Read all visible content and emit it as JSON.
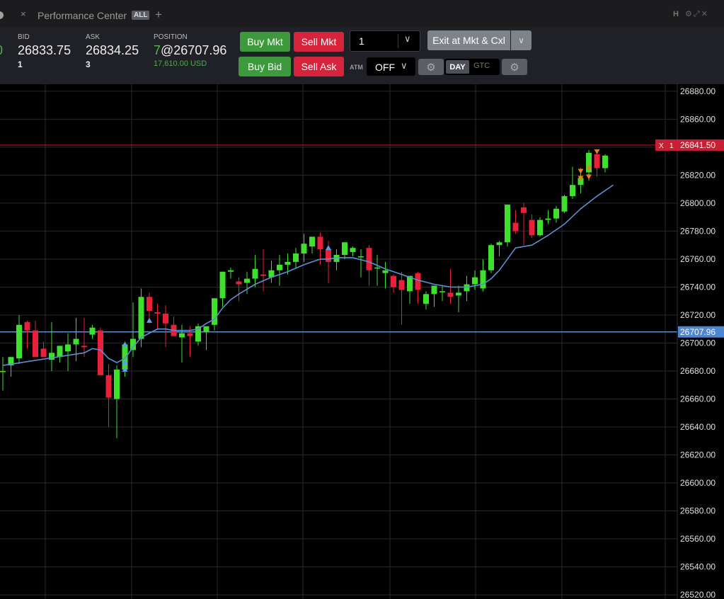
{
  "tab": {
    "title": "Performance Center",
    "badge": "ALL",
    "close_glyph": "×",
    "add_glyph": "+",
    "window_letter": "H"
  },
  "quote": {
    "left_stub": "0",
    "bid_label": "BID",
    "bid_price": "26833.75",
    "bid_size": "1",
    "ask_label": "ASK",
    "ask_price": "26834.25",
    "ask_size": "3",
    "position_label": "POSITION",
    "position_qty": "7",
    "position_price": "@26707.96",
    "position_value": "17,610.00 USD"
  },
  "buttons": {
    "buy_mkt": "Buy Mkt",
    "sell_mkt": "Sell Mkt",
    "buy_bid": "Buy Bid",
    "sell_ask": "Sell Ask",
    "exit": "Exit at Mkt & Cxl"
  },
  "quantity": {
    "value": "1"
  },
  "atm": {
    "label": "ATM",
    "value": "OFF"
  },
  "tif": {
    "day": "DAY",
    "gtc": "GTC",
    "selected": "DAY"
  },
  "icons": {
    "close": "close-icon",
    "add": "plus-icon",
    "gear": "gear-icon",
    "chevron": "chevron-down-icon",
    "settings": "gear-icon",
    "popout": "popout-icon",
    "pin": "pin-icon"
  },
  "colors": {
    "up_candle": "#3fdf2e",
    "down_candle": "#e8203a",
    "ema": "#5d8fd4",
    "order_line": "#c2192f",
    "position_line": "#5b8fd0",
    "buy_button": "#3c9a3c",
    "sell_button": "#d6243d"
  },
  "chart_data": {
    "type": "candlestick",
    "y_axis_ticks": [
      "26880.00",
      "26860.00",
      "26840.00",
      "26820.00",
      "26800.00",
      "26780.00",
      "26760.00",
      "26740.00",
      "26720.00",
      "26700.00",
      "26680.00",
      "26660.00",
      "26640.00",
      "26620.00",
      "26600.00",
      "26580.00",
      "26560.00",
      "26540.00",
      "26520.00"
    ],
    "ylim": [
      26517,
      26885
    ],
    "order_marker": {
      "label_x": "X",
      "label_qty": "1",
      "price": "26841.50"
    },
    "position_marker": {
      "price": "26707.96"
    },
    "candles": [
      [
        26680,
        26690,
        26666,
        26680
      ],
      [
        26684,
        26690,
        26676,
        26690
      ],
      [
        26689,
        26720,
        26685,
        26713
      ],
      [
        26715,
        26716,
        26696,
        26709
      ],
      [
        26709,
        26716,
        26694,
        26690
      ],
      [
        26696,
        26701,
        26690,
        26690
      ],
      [
        26688,
        26715,
        26680,
        26693
      ],
      [
        26690,
        26698,
        26686,
        26698
      ],
      [
        26694,
        26707,
        26680,
        26699
      ],
      [
        26699,
        26718,
        26687,
        26703
      ],
      [
        26698,
        26718,
        26690,
        26697
      ],
      [
        26706,
        26713,
        26703,
        26711
      ],
      [
        26709,
        26711,
        26686,
        26677
      ],
      [
        26677,
        26685,
        26640,
        26661
      ],
      [
        26660,
        26684,
        26632,
        26681
      ],
      [
        26681,
        26701,
        26676,
        26699
      ],
      [
        26695,
        26729,
        26690,
        26703
      ],
      [
        26703,
        26739,
        26697,
        26733
      ],
      [
        26733,
        26736,
        26714,
        26723
      ],
      [
        26722,
        26728,
        26710,
        26721
      ],
      [
        26721,
        26727,
        26697,
        26714
      ],
      [
        26713,
        26719,
        26706,
        26705
      ],
      [
        26704,
        26713,
        26686,
        26707
      ],
      [
        26707,
        26712,
        26690,
        26705
      ],
      [
        26701,
        26714,
        26698,
        26712
      ],
      [
        26708,
        26711,
        26695,
        26712
      ],
      [
        26713,
        26725,
        26709,
        26732
      ],
      [
        26732,
        26751,
        26726,
        26751
      ],
      [
        26751,
        26754,
        26746,
        26752
      ],
      [
        26744,
        26747,
        26730,
        26742
      ],
      [
        26743,
        26751,
        26735,
        26746
      ],
      [
        26746,
        26763,
        26740,
        26753
      ],
      [
        26749,
        26767,
        26737,
        26748
      ],
      [
        26747,
        26759,
        26743,
        26752
      ],
      [
        26752,
        26763,
        26741,
        26756
      ],
      [
        26756,
        26764,
        26749,
        26758
      ],
      [
        26758,
        26768,
        26753,
        26764
      ],
      [
        26764,
        26778,
        26758,
        26771
      ],
      [
        26769,
        26776,
        26764,
        26776
      ],
      [
        26776,
        26779,
        26756,
        26767
      ],
      [
        26767,
        26773,
        26743,
        26758
      ],
      [
        26758,
        26767,
        26752,
        26763
      ],
      [
        26763,
        26772,
        26760,
        26772
      ],
      [
        26765,
        26769,
        26762,
        26768
      ],
      [
        26762,
        26767,
        26747,
        26762
      ],
      [
        26768,
        26770,
        26741,
        26752
      ],
      [
        26754,
        26763,
        26741,
        26754
      ],
      [
        26750,
        26758,
        26739,
        26752
      ],
      [
        26748,
        26749,
        26736,
        26740
      ],
      [
        26745,
        26751,
        26713,
        26738
      ],
      [
        26737,
        26745,
        26728,
        26748
      ],
      [
        26750,
        26751,
        26728,
        26738
      ],
      [
        26728,
        26737,
        26724,
        26735
      ],
      [
        26735,
        26740,
        26726,
        26741
      ],
      [
        26737,
        26741,
        26730,
        26737
      ],
      [
        26736,
        26753,
        26728,
        26733
      ],
      [
        26734,
        26741,
        26722,
        26736
      ],
      [
        26737,
        26748,
        26730,
        26742
      ],
      [
        26742,
        26752,
        26738,
        26747
      ],
      [
        26739,
        26760,
        26737,
        26752
      ],
      [
        26752,
        26771,
        26750,
        26770
      ],
      [
        26770,
        26773,
        26762,
        26772
      ],
      [
        26772,
        26796,
        26769,
        26799
      ],
      [
        26786,
        26795,
        26778,
        26780
      ],
      [
        26797,
        26800,
        26770,
        26793
      ],
      [
        26788,
        26792,
        26775,
        26777
      ],
      [
        26777,
        26790,
        26776,
        26788
      ],
      [
        26788,
        26795,
        26785,
        26789
      ],
      [
        26789,
        26798,
        26786,
        26796
      ],
      [
        26794,
        26806,
        26793,
        26805
      ],
      [
        26805,
        26826,
        26803,
        26813
      ],
      [
        26813,
        26825,
        26807,
        26818
      ],
      [
        26822,
        26838,
        26816,
        26836
      ],
      [
        26835,
        26837,
        26819,
        26825
      ],
      [
        26825,
        26835,
        26822,
        26834
      ]
    ],
    "ema_line": [
      [
        0,
        26684
      ],
      [
        10,
        26693
      ],
      [
        11,
        26696
      ],
      [
        12,
        26695
      ],
      [
        13,
        26689
      ],
      [
        14,
        26686
      ],
      [
        15,
        26689
      ],
      [
        16,
        26697
      ],
      [
        17,
        26704
      ],
      [
        18,
        26707
      ],
      [
        19,
        26710
      ],
      [
        20,
        26710
      ],
      [
        21,
        26709
      ],
      [
        22,
        26709
      ],
      [
        23,
        26709
      ],
      [
        24,
        26710
      ],
      [
        25,
        26714
      ],
      [
        26,
        26717
      ],
      [
        27,
        26725
      ],
      [
        28,
        26731
      ],
      [
        29,
        26735
      ],
      [
        31,
        26742
      ],
      [
        33,
        26747
      ],
      [
        35,
        26751
      ],
      [
        37,
        26756
      ],
      [
        38,
        26758
      ],
      [
        39,
        26760
      ],
      [
        40,
        26760
      ],
      [
        41,
        26761
      ],
      [
        43,
        26761
      ],
      [
        45,
        26758
      ],
      [
        47,
        26753
      ],
      [
        49,
        26749
      ],
      [
        51,
        26745
      ],
      [
        53,
        26742
      ],
      [
        55,
        26740
      ],
      [
        57,
        26740
      ],
      [
        59,
        26742
      ],
      [
        60,
        26746
      ],
      [
        61,
        26752
      ],
      [
        62,
        26760
      ],
      [
        63,
        26768
      ],
      [
        65,
        26770
      ],
      [
        67,
        26777
      ],
      [
        69,
        26785
      ],
      [
        71,
        26796
      ],
      [
        73,
        26805
      ],
      [
        75,
        26813
      ]
    ],
    "buy_markers": [
      {
        "candle": 15,
        "value": 26699
      },
      {
        "candle": 15,
        "value": 26686
      },
      {
        "candle": 15,
        "value": 26681
      },
      {
        "candle": 18,
        "value": 26716
      },
      {
        "candle": 40,
        "value": 26768
      }
    ],
    "sell_markers": [
      {
        "candle": 71,
        "value": 26823
      },
      {
        "candle": 71,
        "value": 26818
      },
      {
        "candle": 72,
        "value": 26825
      },
      {
        "candle": 72,
        "value": 26819
      },
      {
        "candle": 73,
        "value": 26837
      }
    ]
  }
}
